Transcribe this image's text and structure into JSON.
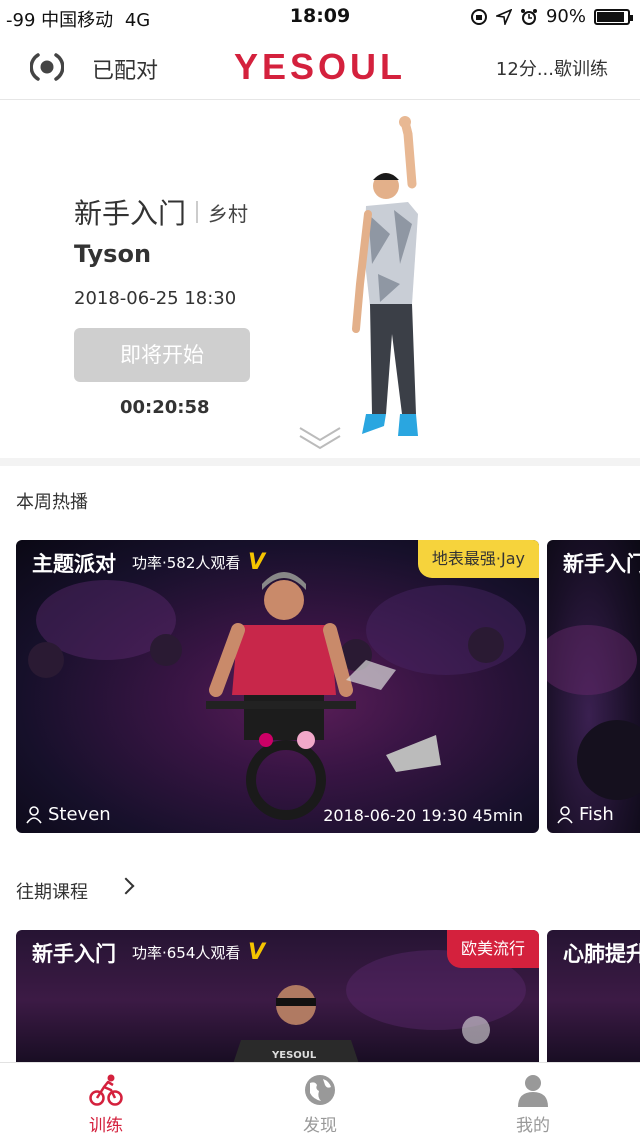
{
  "status_bar": {
    "carrier": "-99 中国移动",
    "network": "4G",
    "time": "18:09",
    "battery": "90%",
    "battery_level": 0.9
  },
  "header": {
    "pair_status": "已配对",
    "logo": "YESOUL",
    "right_label": "12分...歇训练"
  },
  "hero": {
    "title": "新手入门",
    "subtitle": "乡村",
    "coach": "Tyson",
    "datetime": "2018-06-25  18:30",
    "button_label": "即将开始",
    "countdown": "00:20:58"
  },
  "weekly": {
    "section_title": "本周热播",
    "cards": [
      {
        "title": "主题派对",
        "meta": "功率·582人观看",
        "tag": "地表最强·Jay",
        "coach": "Steven",
        "datetime": "2018-06-20  19:30 45min"
      },
      {
        "title": "新手入门",
        "coach": "Fish"
      }
    ]
  },
  "past": {
    "section_title": "往期课程",
    "cards": [
      {
        "title": "新手入门",
        "meta": "功率·654人观看",
        "tag": "欧美流行",
        "jersey_text": "YESOUL"
      },
      {
        "title": "心肺提升"
      }
    ]
  },
  "tabbar": {
    "items": [
      {
        "label": "训练",
        "icon": "cycling-icon",
        "active": true
      },
      {
        "label": "发现",
        "icon": "globe-icon",
        "active": false
      },
      {
        "label": "我的",
        "icon": "user-icon",
        "active": false
      }
    ]
  },
  "colors": {
    "brand_red": "#d4213d",
    "tag_yellow": "#f6d33c",
    "button_disabled": "#cfcfcf"
  }
}
